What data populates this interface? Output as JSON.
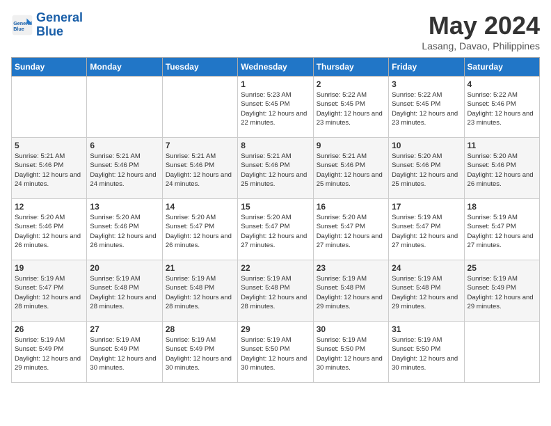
{
  "header": {
    "logo_line1": "General",
    "logo_line2": "Blue",
    "month": "May 2024",
    "location": "Lasang, Davao, Philippines"
  },
  "days_of_week": [
    "Sunday",
    "Monday",
    "Tuesday",
    "Wednesday",
    "Thursday",
    "Friday",
    "Saturday"
  ],
  "weeks": [
    [
      {
        "day": "",
        "info": ""
      },
      {
        "day": "",
        "info": ""
      },
      {
        "day": "",
        "info": ""
      },
      {
        "day": "1",
        "info": "Sunrise: 5:23 AM\nSunset: 5:45 PM\nDaylight: 12 hours\nand 22 minutes."
      },
      {
        "day": "2",
        "info": "Sunrise: 5:22 AM\nSunset: 5:45 PM\nDaylight: 12 hours\nand 23 minutes."
      },
      {
        "day": "3",
        "info": "Sunrise: 5:22 AM\nSunset: 5:45 PM\nDaylight: 12 hours\nand 23 minutes."
      },
      {
        "day": "4",
        "info": "Sunrise: 5:22 AM\nSunset: 5:46 PM\nDaylight: 12 hours\nand 23 minutes."
      }
    ],
    [
      {
        "day": "5",
        "info": "Sunrise: 5:21 AM\nSunset: 5:46 PM\nDaylight: 12 hours\nand 24 minutes."
      },
      {
        "day": "6",
        "info": "Sunrise: 5:21 AM\nSunset: 5:46 PM\nDaylight: 12 hours\nand 24 minutes."
      },
      {
        "day": "7",
        "info": "Sunrise: 5:21 AM\nSunset: 5:46 PM\nDaylight: 12 hours\nand 24 minutes."
      },
      {
        "day": "8",
        "info": "Sunrise: 5:21 AM\nSunset: 5:46 PM\nDaylight: 12 hours\nand 25 minutes."
      },
      {
        "day": "9",
        "info": "Sunrise: 5:21 AM\nSunset: 5:46 PM\nDaylight: 12 hours\nand 25 minutes."
      },
      {
        "day": "10",
        "info": "Sunrise: 5:20 AM\nSunset: 5:46 PM\nDaylight: 12 hours\nand 25 minutes."
      },
      {
        "day": "11",
        "info": "Sunrise: 5:20 AM\nSunset: 5:46 PM\nDaylight: 12 hours\nand 26 minutes."
      }
    ],
    [
      {
        "day": "12",
        "info": "Sunrise: 5:20 AM\nSunset: 5:46 PM\nDaylight: 12 hours\nand 26 minutes."
      },
      {
        "day": "13",
        "info": "Sunrise: 5:20 AM\nSunset: 5:46 PM\nDaylight: 12 hours\nand 26 minutes."
      },
      {
        "day": "14",
        "info": "Sunrise: 5:20 AM\nSunset: 5:47 PM\nDaylight: 12 hours\nand 26 minutes."
      },
      {
        "day": "15",
        "info": "Sunrise: 5:20 AM\nSunset: 5:47 PM\nDaylight: 12 hours\nand 27 minutes."
      },
      {
        "day": "16",
        "info": "Sunrise: 5:20 AM\nSunset: 5:47 PM\nDaylight: 12 hours\nand 27 minutes."
      },
      {
        "day": "17",
        "info": "Sunrise: 5:19 AM\nSunset: 5:47 PM\nDaylight: 12 hours\nand 27 minutes."
      },
      {
        "day": "18",
        "info": "Sunrise: 5:19 AM\nSunset: 5:47 PM\nDaylight: 12 hours\nand 27 minutes."
      }
    ],
    [
      {
        "day": "19",
        "info": "Sunrise: 5:19 AM\nSunset: 5:47 PM\nDaylight: 12 hours\nand 28 minutes."
      },
      {
        "day": "20",
        "info": "Sunrise: 5:19 AM\nSunset: 5:48 PM\nDaylight: 12 hours\nand 28 minutes."
      },
      {
        "day": "21",
        "info": "Sunrise: 5:19 AM\nSunset: 5:48 PM\nDaylight: 12 hours\nand 28 minutes."
      },
      {
        "day": "22",
        "info": "Sunrise: 5:19 AM\nSunset: 5:48 PM\nDaylight: 12 hours\nand 28 minutes."
      },
      {
        "day": "23",
        "info": "Sunrise: 5:19 AM\nSunset: 5:48 PM\nDaylight: 12 hours\nand 29 minutes."
      },
      {
        "day": "24",
        "info": "Sunrise: 5:19 AM\nSunset: 5:48 PM\nDaylight: 12 hours\nand 29 minutes."
      },
      {
        "day": "25",
        "info": "Sunrise: 5:19 AM\nSunset: 5:49 PM\nDaylight: 12 hours\nand 29 minutes."
      }
    ],
    [
      {
        "day": "26",
        "info": "Sunrise: 5:19 AM\nSunset: 5:49 PM\nDaylight: 12 hours\nand 29 minutes."
      },
      {
        "day": "27",
        "info": "Sunrise: 5:19 AM\nSunset: 5:49 PM\nDaylight: 12 hours\nand 30 minutes."
      },
      {
        "day": "28",
        "info": "Sunrise: 5:19 AM\nSunset: 5:49 PM\nDaylight: 12 hours\nand 30 minutes."
      },
      {
        "day": "29",
        "info": "Sunrise: 5:19 AM\nSunset: 5:50 PM\nDaylight: 12 hours\nand 30 minutes."
      },
      {
        "day": "30",
        "info": "Sunrise: 5:19 AM\nSunset: 5:50 PM\nDaylight: 12 hours\nand 30 minutes."
      },
      {
        "day": "31",
        "info": "Sunrise: 5:19 AM\nSunset: 5:50 PM\nDaylight: 12 hours\nand 30 minutes."
      },
      {
        "day": "",
        "info": ""
      }
    ]
  ]
}
